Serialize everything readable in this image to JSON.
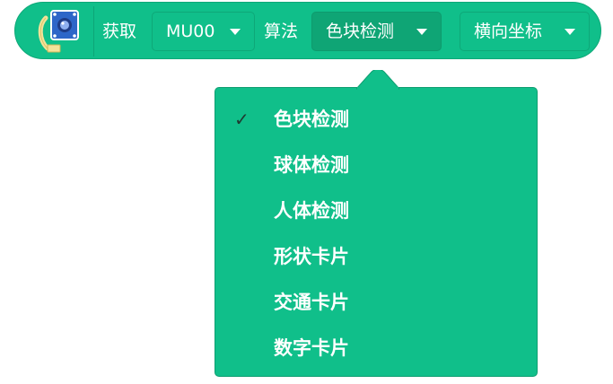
{
  "block": {
    "icon": "camera-module-icon",
    "get_label": "获取",
    "sensor_dropdown": "MU00",
    "algorithm_label": "算法",
    "algorithm_dropdown": "色块检测",
    "property_dropdown": "横向坐标"
  },
  "menu": {
    "selected_index": 0,
    "check_mark": "✓",
    "items": [
      {
        "label": "色块检测",
        "checked": true
      },
      {
        "label": "球体检测",
        "checked": false
      },
      {
        "label": "人体检测",
        "checked": false
      },
      {
        "label": "形状卡片",
        "checked": false
      },
      {
        "label": "交通卡片",
        "checked": false
      },
      {
        "label": "数字卡片",
        "checked": false
      }
    ]
  },
  "colors": {
    "block_fill": "#10bf8a",
    "block_border": "#0ea878",
    "active_dropdown": "#0fa575",
    "menu_fill": "#10bf8a",
    "text": "#ffffff",
    "check_mark": "#1f3a30"
  }
}
